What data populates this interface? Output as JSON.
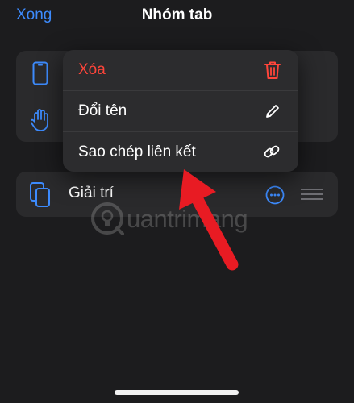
{
  "nav": {
    "done_label": "Xong",
    "title": "Nhóm tab"
  },
  "menu": {
    "items": [
      {
        "label": "Xóa",
        "icon": "trash-icon",
        "destructive": true
      },
      {
        "label": "Đổi tên",
        "icon": "pencil-icon",
        "destructive": false
      },
      {
        "label": "Sao chép liên kết",
        "icon": "link-icon",
        "destructive": false
      }
    ]
  },
  "tab_group_row": {
    "label": "Giải trí"
  },
  "watermark": {
    "text": "uantrimang"
  },
  "colors": {
    "accent": "#3d8bfd",
    "destructive": "#ff453a",
    "background": "#1c1c1e",
    "card": "#2a2a2c",
    "arrow": "#e81b23"
  }
}
